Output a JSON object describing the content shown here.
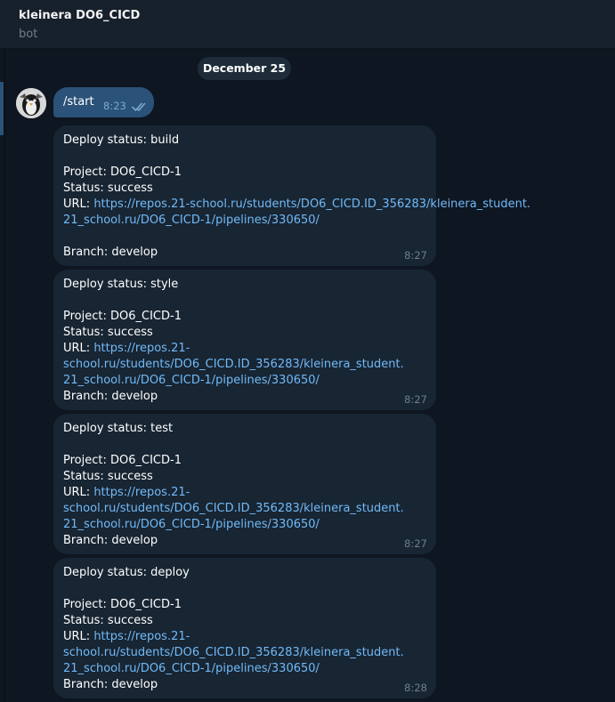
{
  "header": {
    "title": "kleinera DO6_CICD",
    "subtitle": "bot"
  },
  "date_separator": "December 25",
  "outgoing": {
    "text": "/start",
    "time": "8:23"
  },
  "messages": [
    {
      "status_line": "Deploy status: build",
      "project_line": "Project: DO6_CICD-1",
      "status_value_line": "Status: success",
      "url_label": "URL: ",
      "url_line1": "https://repos.21-school.ru/students/DO6_CICD.ID_356283/kleinera_student.",
      "url_line2": "21_school.ru/DO6_CICD-1/pipelines/330650/",
      "branch_line": "Branch: develop",
      "time": "8:27"
    },
    {
      "status_line": "Deploy status: style",
      "project_line": "Project: DO6_CICD-1",
      "status_value_line": "Status: success",
      "url_label": "URL: ",
      "url_line1": "https://repos.21-",
      "url_line2": "school.ru/students/DO6_CICD.ID_356283/kleinera_student.",
      "url_line3": "21_school.ru/DO6_CICD-1/pipelines/330650/",
      "branch_line": "Branch: develop",
      "time": "8:27"
    },
    {
      "status_line": "Deploy status: test",
      "project_line": "Project: DO6_CICD-1",
      "status_value_line": "Status: success",
      "url_label": "URL: ",
      "url_line1": "https://repos.21-",
      "url_line2": "school.ru/students/DO6_CICD.ID_356283/kleinera_student.",
      "url_line3": "21_school.ru/DO6_CICD-1/pipelines/330650/",
      "branch_line": "Branch: develop",
      "time": "8:27"
    },
    {
      "status_line": "Deploy status: deploy",
      "project_line": "Project: DO6_CICD-1",
      "status_value_line": "Status: success",
      "url_label": "URL: ",
      "url_line1": "https://repos.21-",
      "url_line2": "school.ru/students/DO6_CICD.ID_356283/kleinera_student.",
      "url_line3": "21_school.ru/DO6_CICD-1/pipelines/330650/",
      "branch_line": "Branch: develop",
      "time": "8:28"
    }
  ],
  "colors": {
    "background": "#0e1621",
    "header": "#17212b",
    "bubble_in": "#182533",
    "bubble_out": "#2b5278",
    "link": "#71baf7"
  },
  "icons": {
    "read_receipt": "double-check-icon",
    "avatar": "bot-avatar"
  }
}
